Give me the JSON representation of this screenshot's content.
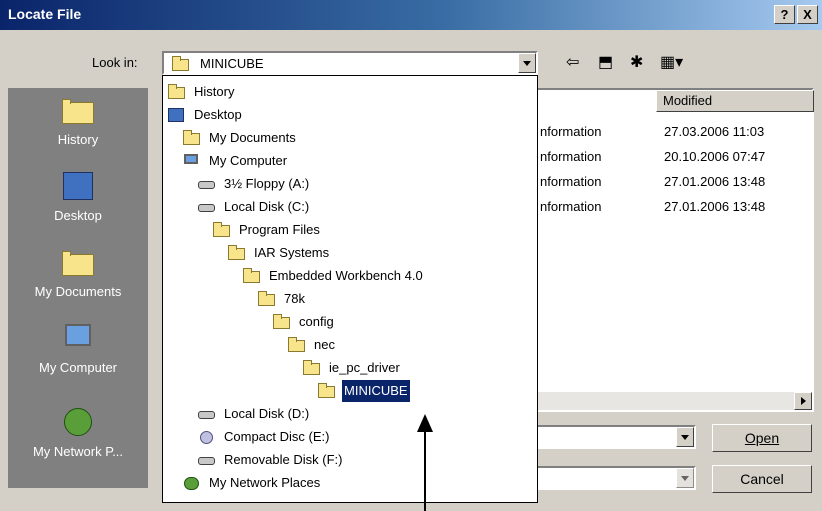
{
  "window": {
    "title": "Locate File",
    "help_label": "?",
    "close_label": "X"
  },
  "lookin": {
    "label": "Look in:",
    "value": "MINICUBE"
  },
  "toolbar": {
    "back_glyph": "⇦",
    "up_glyph": "⬒",
    "newfolder_glyph": "✱",
    "view_glyph": "▦▾"
  },
  "places": [
    {
      "label": "History",
      "icon": "history-folder-icon"
    },
    {
      "label": "Desktop",
      "icon": "desktop-icon"
    },
    {
      "label": "My Documents",
      "icon": "my-documents-icon"
    },
    {
      "label": "My Computer",
      "icon": "my-computer-icon"
    },
    {
      "label": "My Network P...",
      "icon": "my-network-places-icon"
    }
  ],
  "filelist": {
    "columns": [
      "Modified"
    ],
    "rows": [
      {
        "type": "nformation",
        "modified": "27.03.2006 11:03"
      },
      {
        "type": "nformation",
        "modified": "20.10.2006 07:47"
      },
      {
        "type": "nformation",
        "modified": "27.01.2006 13:48"
      },
      {
        "type": "nformation",
        "modified": "27.01.2006 13:48"
      }
    ]
  },
  "buttons": {
    "open": "Open",
    "cancel": "Cancel"
  },
  "dropdown": [
    {
      "label": "History",
      "icon": "folder",
      "indent": 0
    },
    {
      "label": "Desktop",
      "icon": "desktop",
      "indent": 0
    },
    {
      "label": "My Documents",
      "icon": "folder",
      "indent": 1
    },
    {
      "label": "My Computer",
      "icon": "computer",
      "indent": 1
    },
    {
      "label": "3½ Floppy (A:)",
      "icon": "disk",
      "indent": 2
    },
    {
      "label": "Local Disk (C:)",
      "icon": "disk",
      "indent": 2
    },
    {
      "label": "Program Files",
      "icon": "folder",
      "indent": 3
    },
    {
      "label": "IAR Systems",
      "icon": "folder",
      "indent": 4
    },
    {
      "label": "Embedded Workbench 4.0",
      "icon": "folder",
      "indent": 5
    },
    {
      "label": "78k",
      "icon": "folder",
      "indent": 6
    },
    {
      "label": "config",
      "icon": "folder",
      "indent": 7
    },
    {
      "label": "nec",
      "icon": "folder",
      "indent": 8
    },
    {
      "label": "ie_pc_driver",
      "icon": "folder",
      "indent": 9
    },
    {
      "label": "MINICUBE",
      "icon": "folder",
      "indent": 10,
      "selected": true
    },
    {
      "label": "Local Disk (D:)",
      "icon": "disk",
      "indent": 2
    },
    {
      "label": "Compact Disc (E:)",
      "icon": "cd",
      "indent": 2
    },
    {
      "label": "Removable Disk (F:)",
      "icon": "disk",
      "indent": 2
    },
    {
      "label": "My Network Places",
      "icon": "network",
      "indent": 1
    }
  ],
  "colors": {
    "title_start": "#0a246a",
    "title_end": "#a6caf0",
    "face": "#d4d0c8",
    "places_bg": "#808080",
    "selection": "#0a246a"
  }
}
